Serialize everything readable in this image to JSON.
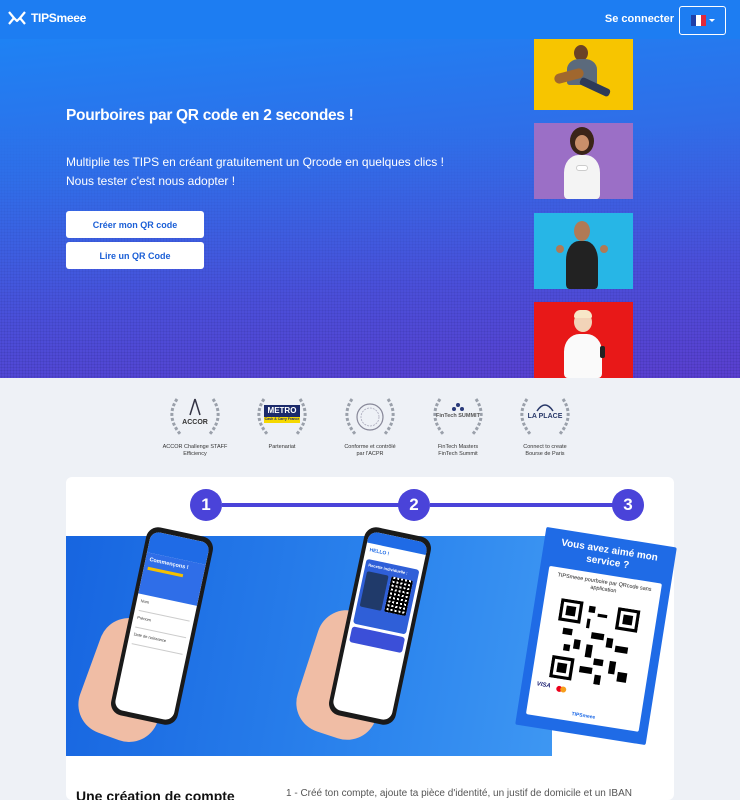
{
  "brand": {
    "name": "TIPSmeee"
  },
  "nav": {
    "login": "Se connecter",
    "language_icon": "flag-france-icon"
  },
  "hero": {
    "title": "Pourboires par QR code en 2 secondes !",
    "subtitle_line1": "Multiplie tes TIPS en créant gratuitement un Qrcode en quelques clics !",
    "subtitle_line2": "Nous tester c'est nous adopter !",
    "buttons": {
      "create": "Créer mon QR code",
      "read": "Lire un QR Code"
    }
  },
  "awards": [
    {
      "logo": "ACCOR",
      "caption_line1": "ACCOR Challenge STAFF",
      "caption_line2": "Efficiency"
    },
    {
      "logo": "METRO",
      "logo_sub": "Cash & Carry France",
      "caption_line1": "Partenariat",
      "caption_line2": ""
    },
    {
      "logo": "ACPR",
      "caption_line1": "Conforme et contrôlé",
      "caption_line2": "par l'ACPR"
    },
    {
      "logo": "FinTech SUMMIT",
      "caption_line1": "FinTech Masters",
      "caption_line2": "FinTech Summit"
    },
    {
      "logo": "LA PLACE",
      "caption_line1": "Connect to create",
      "caption_line2": "Bourse de Paris"
    }
  ],
  "steps": [
    "1",
    "2",
    "3"
  ],
  "phone1": {
    "title": "Commençons !",
    "label_name": "Nom",
    "label_firstname": "Prénom",
    "label_birth": "Date de naissance"
  },
  "phone2": {
    "greeting": "HELLO !",
    "title": "Recette individuelle :"
  },
  "flyer": {
    "title": "Vous avez aimé mon service ?",
    "text": "TIPSmeee pourboire par QRcode sans application",
    "payment": "VISA",
    "brand": "TIPSmeee"
  },
  "lower": {
    "title": "Une création de compte",
    "text": "1 - Créé ton compte, ajoute ta pièce d'identité, un justif de domicile et un IBAN"
  },
  "colors": {
    "nav": "#1d7df2",
    "accent": "#4a43d9",
    "button_text": "#1b5fd6"
  }
}
